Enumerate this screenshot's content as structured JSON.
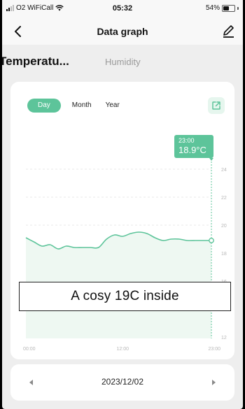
{
  "status_bar": {
    "carrier": "O2 WiFiCall",
    "time": "05:32",
    "battery_percent": "54%",
    "battery_level": 0.54
  },
  "nav": {
    "title": "Data graph",
    "back_icon": "chevron-left-icon",
    "edit_icon": "edit-pencil-icon"
  },
  "metric_tabs": [
    {
      "label": "Temperatu...",
      "active": true
    },
    {
      "label": "Humidity",
      "active": false
    }
  ],
  "period_tabs": [
    {
      "label": "Day",
      "active": true
    },
    {
      "label": "Month",
      "active": false
    },
    {
      "label": "Year",
      "active": false
    }
  ],
  "export_icon": "export-share-icon",
  "tooltip": {
    "time": "23:00",
    "value": "18.9°C"
  },
  "colors": {
    "accent": "#5dc49a",
    "fill": "#eef8f2",
    "grid": "#e2e2e2"
  },
  "chart_data": {
    "type": "area",
    "x_ticks": [
      "00:00",
      "12:00",
      "23:00"
    ],
    "y_ticks": [
      12,
      14,
      16,
      18,
      20,
      22,
      24
    ],
    "ylim": [
      12,
      25
    ],
    "xlim": [
      0,
      23
    ],
    "grid": true,
    "series": [
      {
        "values_x": [
          0,
          1,
          2,
          3,
          4,
          5,
          6,
          7,
          8,
          9,
          10,
          11,
          12,
          13,
          14,
          15,
          16,
          17,
          18,
          19,
          20,
          21,
          22,
          23
        ],
        "values_y": [
          19.1,
          18.8,
          18.5,
          18.6,
          18.3,
          18.5,
          18.4,
          18.4,
          18.4,
          18.4,
          19.0,
          19.3,
          19.2,
          19.4,
          19.5,
          19.4,
          19.1,
          18.9,
          19.0,
          19.0,
          18.9,
          18.9,
          18.9,
          18.9
        ]
      }
    ],
    "selected_x": 23
  },
  "overlay_text": "A cosy 19C inside",
  "date_selector": {
    "date": "2023/12/02",
    "prev_icon": "triangle-left-icon",
    "next_icon": "triangle-right-icon"
  }
}
